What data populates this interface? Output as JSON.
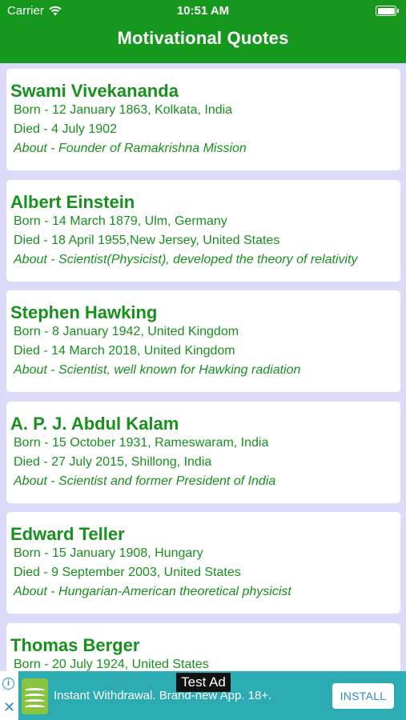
{
  "status_bar": {
    "carrier": "Carrier",
    "time": "10:51 AM",
    "battery_level": 1.0
  },
  "header": {
    "title": "Motivational Quotes",
    "background": "#16981e"
  },
  "people": [
    {
      "name": "Swami Vivekananda",
      "born": "Born - 12 January 1863, Kolkata, India",
      "died": "Died -  4 July 1902",
      "about": "About - Founder of Ramakrishna Mission"
    },
    {
      "name": "Albert Einstein",
      "born": "Born - 14 March 1879, Ulm, Germany",
      "died": "Died - 18 April 1955,New Jersey, United States",
      "about": "About - Scientist(Physicist), developed the theory of relativity"
    },
    {
      "name": "Stephen Hawking",
      "born": "Born - 8 January 1942, United Kingdom",
      "died": "Died - 14 March 2018, United Kingdom",
      "about": "About - Scientist, well known for Hawking radiation"
    },
    {
      "name": "A. P. J. Abdul Kalam",
      "born": "Born - 15 October 1931, Rameswaram, India",
      "died": "Died -  27 July 2015, Shillong, India",
      "about": "About - Scientist and former President of India"
    },
    {
      "name": "Edward Teller",
      "born": "Born - 15 January 1908, Hungary",
      "died": "Died - 9 September 2003, United States",
      "about": "About - Hungarian-American theoretical physicist"
    },
    {
      "name": "Thomas Berger",
      "born": "Born - 20 July 1924, United States",
      "died": "",
      "about": ""
    }
  ],
  "ad": {
    "label": "Test Ad",
    "text": "Instant Withdrawal. Brand-new App. 18+.",
    "install_label": "INSTALL",
    "info_icon": "i",
    "close_icon": "✕"
  },
  "colors": {
    "accent_green": "#16981e",
    "card_text": "#18901d",
    "list_background": "#dcdcfa",
    "ad_background": "#2cabb2"
  }
}
